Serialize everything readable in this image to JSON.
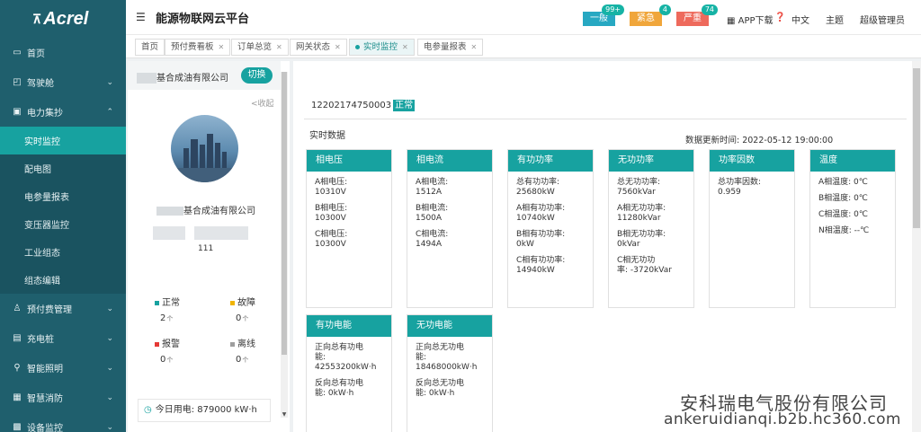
{
  "sidebar": {
    "logo": "Acrel",
    "items": [
      {
        "label": "首页",
        "icon": "monitor-icon"
      },
      {
        "label": "驾驶舱",
        "icon": "dashboard-icon"
      },
      {
        "label": "电力集抄",
        "icon": "meter-icon"
      },
      {
        "label": "预付费管理",
        "icon": "user-icon"
      },
      {
        "label": "充电桩",
        "icon": "charger-icon"
      },
      {
        "label": "智能照明",
        "icon": "location-icon"
      },
      {
        "label": "智慧消防",
        "icon": "fire-icon"
      },
      {
        "label": "设备监控",
        "icon": "device-icon"
      }
    ],
    "sub_items": [
      "实时监控",
      "配电图",
      "电参量报表",
      "变压器监控",
      "工业组态",
      "组态编辑"
    ]
  },
  "header": {
    "title": "能源物联网云平台",
    "alarms": [
      {
        "label": "一般",
        "count": "99+",
        "color": "#27a8c2"
      },
      {
        "label": "紧急",
        "count": "4",
        "color": "#f0a63b"
      },
      {
        "label": "严重",
        "count": "74",
        "color": "#ee6a5c"
      }
    ],
    "app_download": "APP下载",
    "language": "中文",
    "theme": "主题",
    "user": "超级管理员"
  },
  "tabs": [
    "首页",
    "预付费看板",
    "订单总览",
    "网关状态",
    "实时监控",
    "电参量报表"
  ],
  "left_panel": {
    "company": "基合成油有限公司",
    "switch": "切换",
    "collapse": "<收起",
    "company_name": "基合成油有限公司",
    "user_code": "111",
    "stats": [
      {
        "label": "正常",
        "value": "2",
        "unit": "个",
        "color": "#17a2a0"
      },
      {
        "label": "故障",
        "value": "0",
        "unit": "个",
        "color": "#f0b400"
      },
      {
        "label": "报警",
        "value": "0",
        "unit": "个",
        "color": "#e53935"
      },
      {
        "label": "离线",
        "value": "0",
        "unit": "个",
        "color": "#9e9e9e"
      }
    ],
    "today": "今日用电: 879000 kW·h"
  },
  "main": {
    "device_id": "12202174750003",
    "status": "正常",
    "section_title": "实时数据",
    "update_time": "数据更新时间: 2022-05-12 19:00:00",
    "cards": [
      {
        "title": "相电压",
        "rows": [
          "A相电压:\n10310V",
          "B相电压:\n10300V",
          "C相电压:\n10300V"
        ]
      },
      {
        "title": "相电流",
        "rows": [
          "A相电流:\n1512A",
          "B相电流:\n1500A",
          "C相电流:\n1494A"
        ]
      },
      {
        "title": "有功功率",
        "rows": [
          "总有功功率:\n25680kW",
          "A相有功功率:\n10740kW",
          "B相有功功率:\n0kW",
          "C相有功功率:\n14940kW"
        ]
      },
      {
        "title": "无功功率",
        "rows": [
          "总无功功率:\n7560kVar",
          "A相无功功率:\n11280kVar",
          "B相无功功率:\n0kVar",
          "C相无功功\n率: -3720kVar"
        ]
      },
      {
        "title": "功率因数",
        "rows": [
          "总功率因数:\n0.959"
        ]
      },
      {
        "title": "温度",
        "rows": [
          "A相温度: 0℃",
          "B相温度: 0℃",
          "C相温度: 0℃",
          "N相温度: --℃"
        ]
      },
      {
        "title": "有功电能",
        "rows": [
          "正向总有功电\n能:\n42553200kW·h",
          "反向总有功电\n能: 0kW·h"
        ]
      },
      {
        "title": "无功电能",
        "rows": [
          "正向总无功电\n能:\n18468000kW·h",
          "反向总无功电\n能: 0kW·h"
        ]
      }
    ]
  },
  "watermark": {
    "line1": "安科瑞电气股份有限公司",
    "line2": "ankeruidianqi.b2b.hc360.com"
  }
}
